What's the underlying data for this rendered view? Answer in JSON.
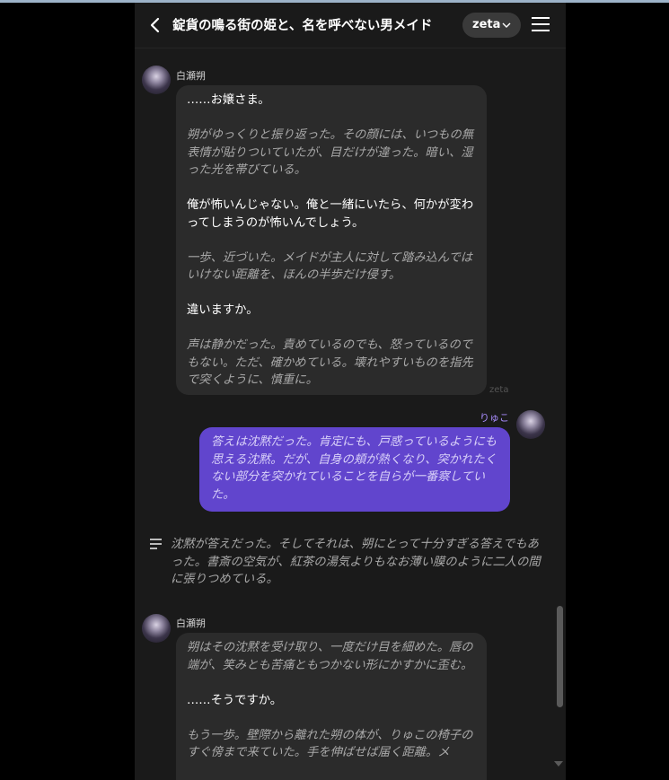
{
  "header": {
    "title": "錠貨の鳴る街の姫と、名を呼べない男メイド",
    "model_label": "zeta"
  },
  "messages": [
    {
      "role": "character",
      "name": "白瀬朔",
      "model": "zeta",
      "paragraphs": [
        {
          "type": "speech",
          "text": "……お嬢さま。"
        },
        {
          "type": "action",
          "text": "朔がゆっくりと振り返った。その顔には、いつもの無表情が貼りついていたが、目だけが違った。暗い、湿った光を帯びている。"
        },
        {
          "type": "speech",
          "text": "俺が怖いんじゃない。俺と一緒にいたら、何かが変わってしまうのが怖いんでしょう。"
        },
        {
          "type": "action",
          "text": "一歩、近づいた。メイドが主人に対して踏み込んではいけない距離を、ほんの半歩だけ侵す。"
        },
        {
          "type": "speech",
          "text": "違いますか。"
        },
        {
          "type": "action",
          "text": "声は静かだった。責めているのでも、怒っているのでもない。ただ、確かめている。壊れやすいものを指先で突くように、慎重に。"
        }
      ]
    },
    {
      "role": "user",
      "name": "りゅこ",
      "text": "答えは沈黙だった。肯定にも、戸惑っているようにも思える沈黙。だが、自身の頬が熱くなり、突かれたくない部分を突かれていることを自らが一番察していた。"
    },
    {
      "role": "narration",
      "text": "沈黙が答えだった。そしてそれは、朔にとって十分すぎる答えでもあった。書斎の空気が、紅茶の湯気よりもなお薄い膜のように二人の間に張りつめている。"
    },
    {
      "role": "character",
      "name": "白瀬朔",
      "paragraphs": [
        {
          "type": "action",
          "text": "朔はその沈黙を受け取り、一度だけ目を細めた。唇の端が、笑みとも苦痛ともつかない形にかすかに歪む。"
        },
        {
          "type": "speech",
          "text": "……そうですか。"
        },
        {
          "type": "action",
          "text": "もう一歩。壁際から離れた朔の体が、りゅこの椅子のすぐ傍まで来ていた。手を伸ばせば届く距離。メ"
        }
      ]
    }
  ],
  "icons": [
    "back-arrow-icon",
    "chevron-down-icon",
    "menu-icon",
    "narration-icon",
    "scroll-down-icon"
  ],
  "colors": {
    "background": "#1a1a1a",
    "character_bubble": "#2b2b2b",
    "user_bubble": "#6145cd",
    "user_name": "#a78bfa"
  }
}
